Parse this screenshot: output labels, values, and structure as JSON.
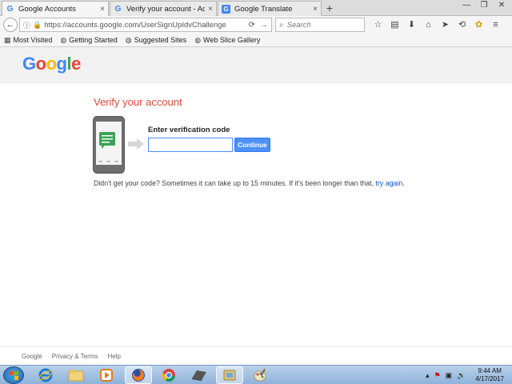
{
  "tabs": [
    {
      "title": "Google Accounts",
      "favicon": "G",
      "close": "×",
      "active": true
    },
    {
      "title": "Verify your account - Acco...",
      "favicon": "G",
      "close": "×",
      "active": false
    },
    {
      "title": "Google Translate",
      "favicon": "G",
      "close": "×",
      "active": false
    }
  ],
  "new_tab": "+",
  "window_controls": {
    "minimize": "—",
    "maximize": "❐",
    "close": "✕"
  },
  "navbar": {
    "url": "https://accounts.google.com/UserSignUpIdvChallenge",
    "search_placeholder": "Search"
  },
  "bookmarks": [
    {
      "label": "Most Visited",
      "icon": "bookmark-icon"
    },
    {
      "label": "Getting Started",
      "icon": "globe-icon"
    },
    {
      "label": "Suggested Sites",
      "icon": "globe-icon"
    },
    {
      "label": "Web Slice Gallery",
      "icon": "globe-icon"
    }
  ],
  "logo": {
    "letters": [
      "G",
      "o",
      "o",
      "g",
      "l",
      "e"
    ],
    "colors": [
      "#4285f4",
      "#ea4335",
      "#fbbc05",
      "#4285f4",
      "#34a853",
      "#ea4335"
    ]
  },
  "main": {
    "title": "Verify your account",
    "code_label": "Enter verification code",
    "code_value": "",
    "continue_label": "Continue",
    "help_text": "Didn't get your code? Sometimes it can take up to 15 minutes. If it's been longer than that, ",
    "try_again": "try again",
    "help_end": "."
  },
  "footer": {
    "items": [
      "Google",
      "Privacy & Terms",
      "Help"
    ]
  },
  "taskbar": {
    "time": "9:44 AM",
    "date": "4/17/2017"
  },
  "colors": {
    "title_red": "#dd4b39",
    "button_blue": "#4d90fe",
    "link_blue": "#15c"
  }
}
